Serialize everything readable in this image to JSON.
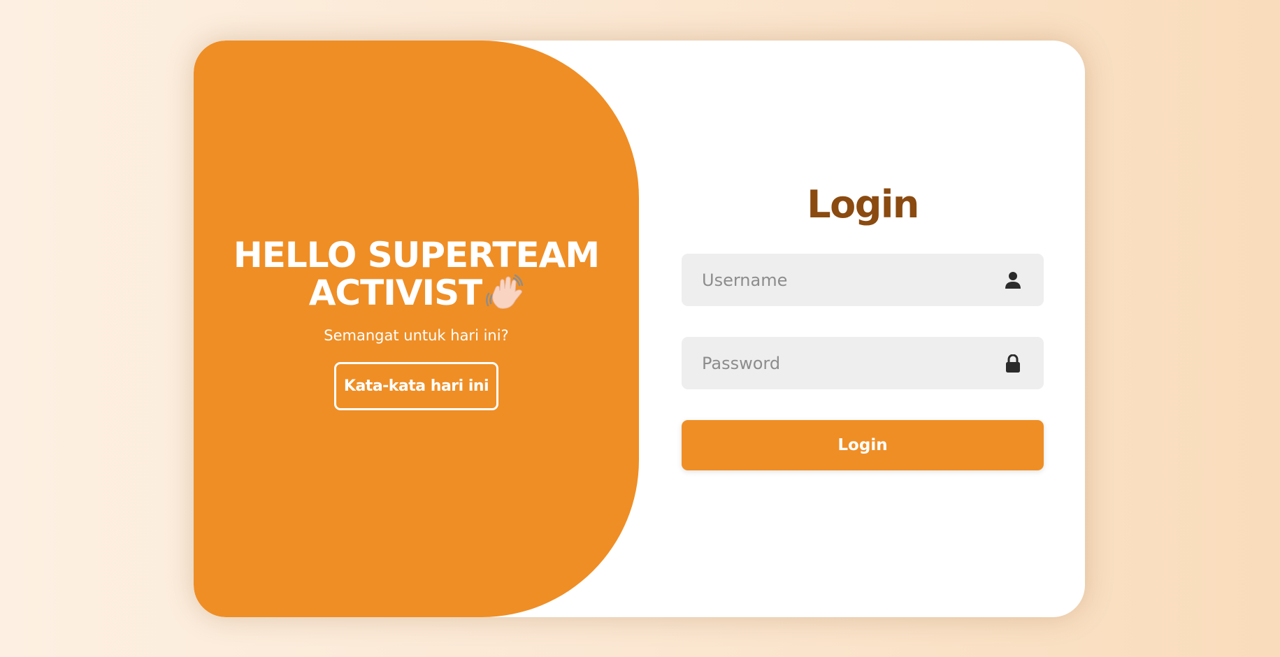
{
  "welcome": {
    "title": "HELLO SUPERTEAM ACTIVIST",
    "emoji_icon": "waving-hand-icon",
    "subtitle": "Semangat untuk hari ini?",
    "quote_button_label": "Kata-kata hari ini"
  },
  "login": {
    "title": "Login",
    "username_placeholder": "Username",
    "username_icon": "user-icon",
    "password_placeholder": "Password",
    "password_icon": "lock-icon",
    "submit_label": "Login"
  },
  "colors": {
    "accent": "#ef8e25",
    "title_brown": "#8a4a10",
    "field_bg": "#eeeeee",
    "card_bg": "#ffffff"
  }
}
